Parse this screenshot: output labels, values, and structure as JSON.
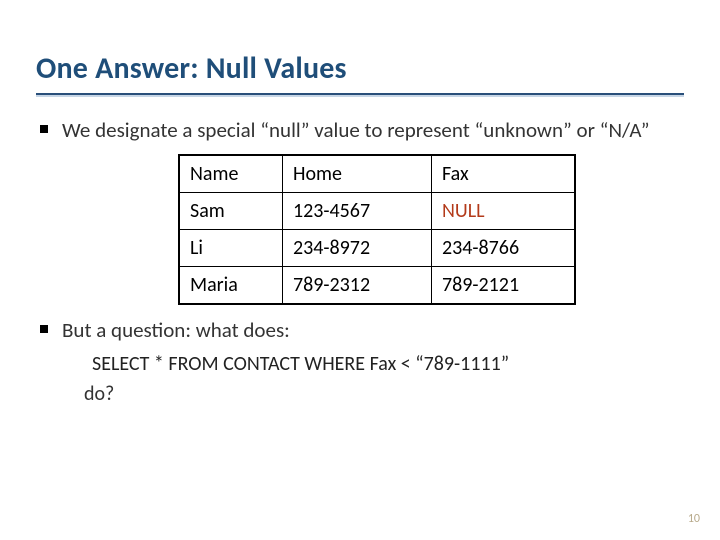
{
  "title": "One Answer:  Null Values",
  "bullets": {
    "b1": "We designate a special “null” value to represent “unknown” or “N/A”",
    "b2": "But a question:  what does:"
  },
  "table": {
    "headers": {
      "name": "Name",
      "home": "Home",
      "fax": "Fax"
    },
    "rows": [
      {
        "name": "Sam",
        "home": "123-4567",
        "fax": "NULL",
        "fax_null": true
      },
      {
        "name": "Li",
        "home": "234-8972",
        "fax": "234-8766",
        "fax_null": false
      },
      {
        "name": "Maria",
        "home": "789-2312",
        "fax": "789-2121",
        "fax_null": false
      }
    ]
  },
  "sql": "SELECT * FROM CONTACT WHERE Fax < “789-1111”",
  "do_text": "do?",
  "page_number": "10"
}
